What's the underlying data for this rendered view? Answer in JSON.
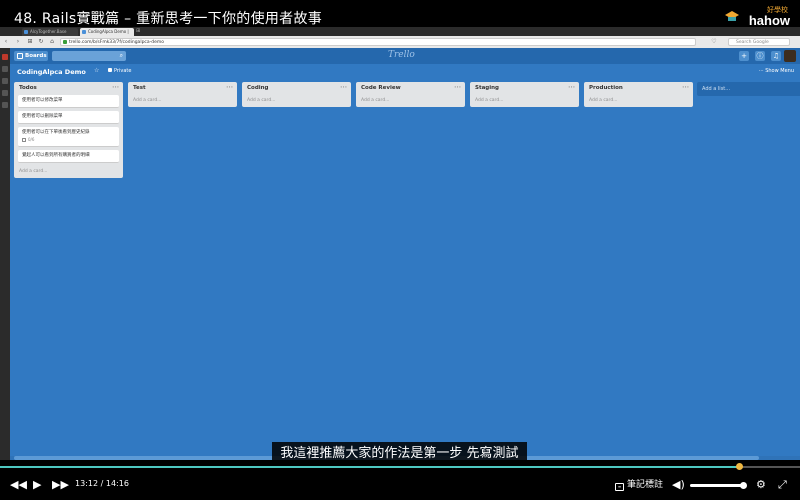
{
  "video": {
    "title": "48. Rails實戰篇 – 重新思考一下你的使用者故事",
    "logo_small": "好學校",
    "logo_text": "hahow",
    "subtitle": "我這裡推薦大家的作法是第一步 先寫測試",
    "progress": 0.924,
    "time_current": "13:12",
    "time_separator": "/",
    "time_total": "14:16",
    "notes_label": "筆記標註",
    "volume": 1.0
  },
  "browser": {
    "tabs": [
      {
        "label": "AlcyTogether.Base",
        "active": false
      },
      {
        "label": "CodingAlpca Demo | Trello",
        "active": true
      }
    ],
    "url": "trello.com/b/sFmk33/7f/codingalpca-demo",
    "search_placeholder": "Search Google",
    "scroll_status": "100%"
  },
  "trello": {
    "boards_label": "Boards",
    "logo": "Trello",
    "board_name": "CodingAlpca Demo",
    "privacy": "Private",
    "show_menu": "Show Menu",
    "add_list": "Add a list...",
    "add_card": "Add a card...",
    "lists": [
      {
        "name": "Todos",
        "cards": [
          {
            "text": "使用者可以修改菜單"
          },
          {
            "text": "使用者可以刪除菜單"
          },
          {
            "text": "使用者可以在下單後看到歷史紀錄",
            "badge": "0/6"
          },
          {
            "text": "覺起人可以看到所有購買者的明細"
          }
        ]
      },
      {
        "name": "Test",
        "cards": []
      },
      {
        "name": "Coding",
        "cards": []
      },
      {
        "name": "Code Review",
        "cards": []
      },
      {
        "name": "Staging",
        "cards": []
      },
      {
        "name": "Production",
        "cards": []
      }
    ]
  },
  "colors": {
    "board_blue": "#3179c2",
    "header_blue": "#2568ad",
    "list_gray": "#e2e4e6",
    "progress_teal": "#4ec7c0",
    "knob_orange": "#f0b842"
  }
}
